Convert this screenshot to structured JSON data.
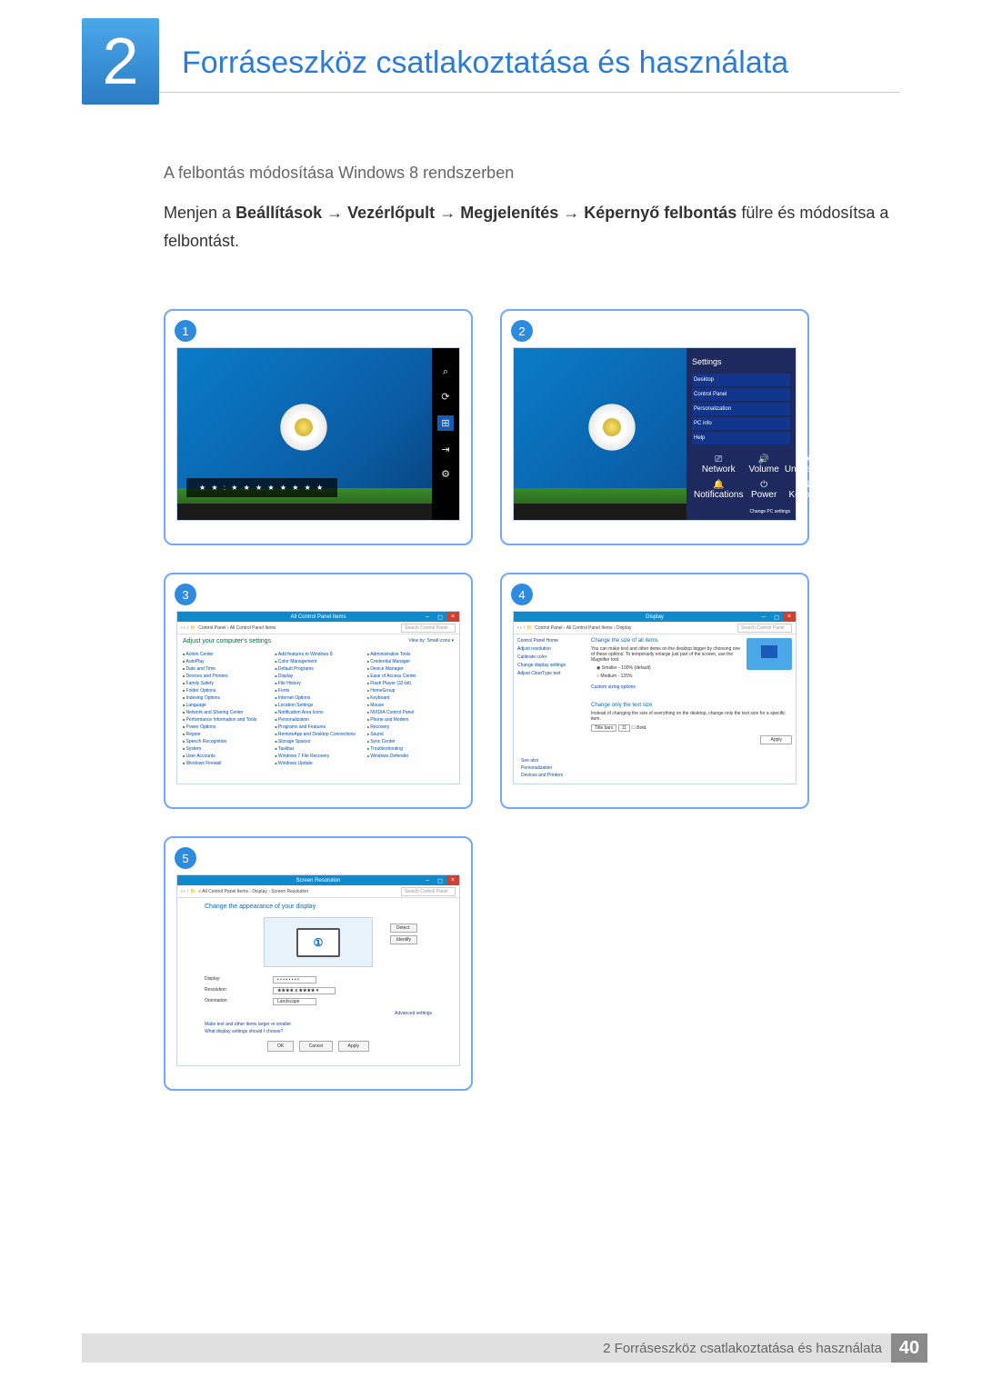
{
  "chapter": {
    "num": "2",
    "title": "Forráseszköz csatlakoztatása és használata"
  },
  "section": {
    "subtitle": "A felbontás módosítása Windows 8 rendszerben"
  },
  "body": {
    "prefix": "Menjen a ",
    "p1": "Beállítások",
    "a1": "→",
    "p2": "Vezérlőpult",
    "a2": "→",
    "p3": "Megjelenítés",
    "a3": "→",
    "p4": "Képernyő felbontás",
    "suffix": " fülre és módosítsa a felbontást."
  },
  "steps": {
    "s1": "1",
    "s2": "2",
    "s3": "3",
    "s4": "4",
    "s5": "5"
  },
  "charms": {
    "search": "⌕",
    "share": "⟳",
    "start": "⊞",
    "devices": "⇥",
    "settings": "⚙",
    "time": "★ ★ : ★ ★\n★ ★ ★ ★  ★ ★"
  },
  "settingsPanel": {
    "title": "Settings",
    "items": [
      "Desktop",
      "Control Panel",
      "Personalization",
      "PC info",
      "Help"
    ],
    "grid": [
      {
        "icon": "⎚",
        "label": "Network"
      },
      {
        "icon": "🔊",
        "label": "Volume"
      },
      {
        "icon": "☀",
        "label": "Unavailable"
      },
      {
        "icon": "🔔",
        "label": "Notifications"
      },
      {
        "icon": "⏻",
        "label": "Power"
      },
      {
        "icon": "⌨",
        "label": "Keyboard"
      }
    ],
    "change": "Change PC settings"
  },
  "cp": {
    "title": "All Control Panel Items",
    "crumb": "Control Panel  ›  All Control Panel Items",
    "searchPh": "Search Control Panel",
    "heading": "Adjust your computer's settings",
    "view": "View by:   Small icons ▾",
    "items": [
      "Action Center",
      "Add features to Windows 8",
      "Administrative Tools",
      "AutoPlay",
      "Color Management",
      "Credential Manager",
      "Date and Time",
      "Default Programs",
      "Device Manager",
      "Devices and Printers",
      "Display",
      "Ease of Access Center",
      "Family Safety",
      "File History",
      "Flash Player (32-bit)",
      "Folder Options",
      "Fonts",
      "HomeGroup",
      "Indexing Options",
      "Internet Options",
      "Keyboard",
      "Language",
      "Location Settings",
      "Mouse",
      "Network and Sharing Center",
      "Notification Area Icons",
      "NVIDIA Control Panel",
      "Performance Information and Tools",
      "Personalization",
      "Phone and Modem",
      "Power Options",
      "Programs and Features",
      "Recovery",
      "Region",
      "RemoteApp and Desktop Connections",
      "Sound",
      "Speech Recognition",
      "Storage Spaces",
      "Sync Center",
      "System",
      "Taskbar",
      "Troubleshooting",
      "User Accounts",
      "Windows 7 File Recovery",
      "Windows Defender",
      "Windows Firewall",
      "Windows Update"
    ]
  },
  "display": {
    "title": "Display",
    "crumb": "Control Panel  ›  All Control Panel Items  ›  Display",
    "side": [
      "Control Panel Home",
      "Adjust resolution",
      "Calibrate color",
      "Change display settings",
      "Adjust ClearType text"
    ],
    "hd": "Change the size of all items",
    "desc": "You can make text and other items on the desktop bigger by choosing one of these options. To temporarily enlarge just part of the screen, use the Magnifier tool.",
    "opt1": "Smaller - 100% (default)",
    "opt2": "Medium - 125%",
    "custom": "Custom sizing options",
    "txthd": "Change only the text size",
    "txtdesc": "Instead of changing the size of everything on the desktop, change only the text size for a specific item.",
    "select1": "Title bars",
    "select2": "11",
    "bold": "Bold",
    "apply": "Apply",
    "seeAlso": "See also",
    "seeItems": [
      "Personalization",
      "Devices and Printers"
    ]
  },
  "res": {
    "title": "Screen Resolution",
    "crumb": "« All Control Panel Items  ›  Display  ›  Screen Resolution",
    "hd": "Change the appearance of your display",
    "detect": "Detect",
    "identify": "Identify",
    "monNum": "①",
    "rows": {
      "display": {
        "label": "Display:",
        "val": "• • • • • • • •"
      },
      "resolution": {
        "label": "Resolution:",
        "val": "★★★★ x ★★★★ ▾"
      },
      "orientation": {
        "label": "Orientation:",
        "val": "Landscape"
      }
    },
    "adv": "Advanced settings",
    "link1": "Make text and other items larger or smaller",
    "link2": "What display settings should I choose?",
    "ok": "OK",
    "cancel": "Cancel",
    "apply": "Apply"
  },
  "footer": {
    "text": "2 Forráseszköz csatlakoztatása és használata",
    "page": "40"
  }
}
